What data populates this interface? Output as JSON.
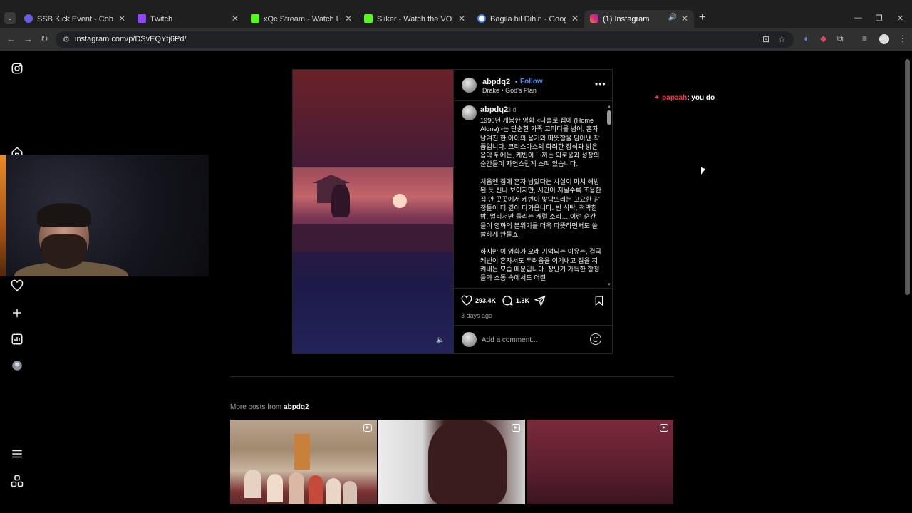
{
  "browser": {
    "tabs": [
      {
        "title": "SSB Kick Event - Cobalt Studios",
        "icon": "cobalt-icon",
        "color": "#6b5ce7"
      },
      {
        "title": "Twitch",
        "icon": "twitch-icon",
        "color": "#9146ff"
      },
      {
        "title": "xQc Stream - Watch Live on Kick",
        "icon": "kick-icon",
        "color": "#53fc18"
      },
      {
        "title": "Sliker - Watch the VOD on Kick",
        "icon": "kick-icon",
        "color": "#53fc18"
      },
      {
        "title": "Bagila bil Dihin - Google Search",
        "icon": "google-icon",
        "color": "#ffffff"
      },
      {
        "title": "(1) Instagram",
        "icon": "instagram-icon",
        "color": "#e1306c",
        "active": true
      }
    ],
    "url": "instagram.com/p/DSvEQYtj6Pd/"
  },
  "post": {
    "username": "abpdq2",
    "follow_label": "Follow",
    "song": "Drake • God's Plan",
    "caption_time": "3 d",
    "caption": [
      "1990년 개봉한 영화 <나홀로 집에 (Home Alone)>는 단순한 가족 코미디를 넘어, 혼자 남겨진 한 아이의 용기와 따뜻함을 담아낸 작품입니다. 크리스마스의 화려한 장식과 밝은 음악 뒤에는, 케빈이 느끼는 외로움과 성장의 순간들이 자연스럽게 스며 있습니다.",
      "처음엔 집에 혼자 남았다는 사실이 마치 해방된 듯 신나 보이지만, 시간이 지날수록 조용한 집 안 곳곳에서 케빈이 맞닥뜨리는 고요한 감정들이 더 깊이 다가옵니다. 빈 식탁, 적막한 밤, 멀리서만 들리는 캐럴 소리… 이런 순간들이 영화의 분위기를 더욱 따뜻하면서도 쓸쓸하게 만들죠.",
      "하지만 이 영화가 오래 기억되는 이유는, 결국 케빈이 혼자서도 두려움을 이겨내고 집을 지켜내는 모습 때문입니다. 장난기 가득한 함정들과 소동 속에서도 어린"
    ],
    "likes": "293.4K",
    "comments": "1.3K",
    "posted_ago": "3 days ago",
    "comment_placeholder": "Add a comment..."
  },
  "chat": {
    "user": "papaah",
    "message": ": you do"
  },
  "more_posts": {
    "prefix": "More posts from ",
    "username": "abpdq2"
  }
}
